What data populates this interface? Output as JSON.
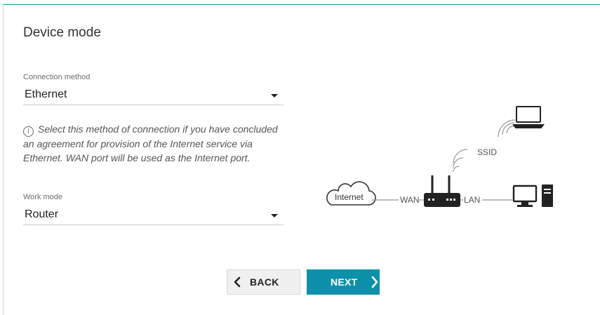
{
  "page": {
    "title": "Device mode"
  },
  "connection": {
    "label": "Connection method",
    "value": "Ethernet",
    "hint": "Select this method of connection if you have concluded an agreement for provision of the Internet service via Ethernet. WAN port will be used as the Internet port."
  },
  "work_mode": {
    "label": "Work mode",
    "value": "Router"
  },
  "diagram": {
    "internet_label": "Internet",
    "wan_label": "WAN",
    "lan_label": "LAN",
    "ssid_label": "SSID"
  },
  "buttons": {
    "back_label": "BACK",
    "next_label": "NEXT"
  },
  "colors": {
    "accent": "#0e90ab",
    "back_button": "#f0f0f0"
  },
  "icons": {
    "info": "info-icon",
    "back": "chevron-left-icon",
    "next": "chevron-right-icon"
  }
}
